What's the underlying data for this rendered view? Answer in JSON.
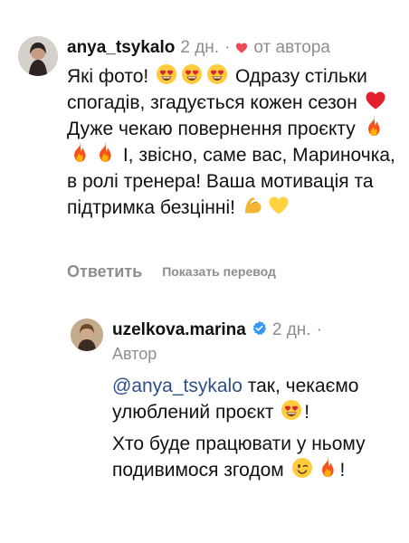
{
  "comment": {
    "username": "anya_tsykalo",
    "time": "2 дн.",
    "separator": "·",
    "liked_by_author": "от автора",
    "text_parts": [
      "Які фото!",
      "Одразу стільки спогадів, згадується кожен сезон",
      "Дуже чекаю повернення проєкту",
      "І, звісно, саме вас, Мариночка, в ролі тренера! Ваша мотивація та підтримка безцінні!"
    ],
    "reply_label": "Ответить",
    "translate_label": "Показать перевод"
  },
  "reply": {
    "username": "uzelkova.marina",
    "time": "2 дн.",
    "separator": "·",
    "author_label": "Автор",
    "mention": "@anya_tsykalo",
    "line1_rest": " так, чекаємо улюблений проєкт",
    "line1_end": "!",
    "line2": "Хто буде працювати у ньому подивимося згодом",
    "line2_end": "!"
  },
  "icons": {
    "heart_color": "#ed4956",
    "verified_color": "#3897f0",
    "emoji": [
      "heart-eyes-emoji",
      "red-heart-emoji",
      "fire-emoji",
      "flexed-biceps-emoji",
      "yellow-heart-emoji",
      "winking-face-emoji"
    ]
  }
}
